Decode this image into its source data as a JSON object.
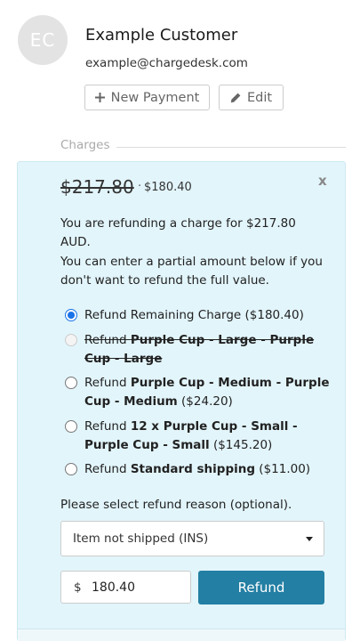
{
  "customer": {
    "initials": "EC",
    "name": "Example Customer",
    "email": "example@chargedesk.com"
  },
  "actions": {
    "new_payment_label": "New Payment",
    "edit_label": "Edit"
  },
  "section": {
    "label": "Charges"
  },
  "refund_panel": {
    "original_amount": "$217.80",
    "separator": "·",
    "remaining_amount": "$180.40",
    "close_label": "x",
    "message": "You are refunding a charge for $217.80 AUD.",
    "partial_message": "You can enter a partial amount below if you don't want to refund the full value.",
    "options": [
      {
        "prefix": "Refund Remaining Charge ($180.40)",
        "item": "",
        "suffix": "",
        "checked": true,
        "disabled": false
      },
      {
        "prefix": "Refund ",
        "item": "Purple Cup - Large - Purple Cup - Large",
        "suffix": "",
        "checked": false,
        "disabled": true
      },
      {
        "prefix": "Refund ",
        "item": "Purple Cup - Medium - Purple Cup - Medium",
        "suffix": " ($24.20)",
        "checked": false,
        "disabled": false
      },
      {
        "prefix": "Refund ",
        "item": "12 x Purple Cup - Small - Purple Cup - Small",
        "suffix": " ($145.20)",
        "checked": false,
        "disabled": false
      },
      {
        "prefix": "Refund ",
        "item": "Standard shipping",
        "suffix": " ($11.00)",
        "checked": false,
        "disabled": false
      }
    ],
    "reason_label": "Please select refund reason (optional).",
    "reason_selected": "Item not shipped (INS)",
    "currency_symbol": "$",
    "amount_value": "180.40",
    "refund_button_label": "Refund"
  },
  "colors": {
    "panel_bg": "#e2f5fb",
    "refund_button": "#237fa3",
    "radio_accent": "#1a73e8"
  }
}
